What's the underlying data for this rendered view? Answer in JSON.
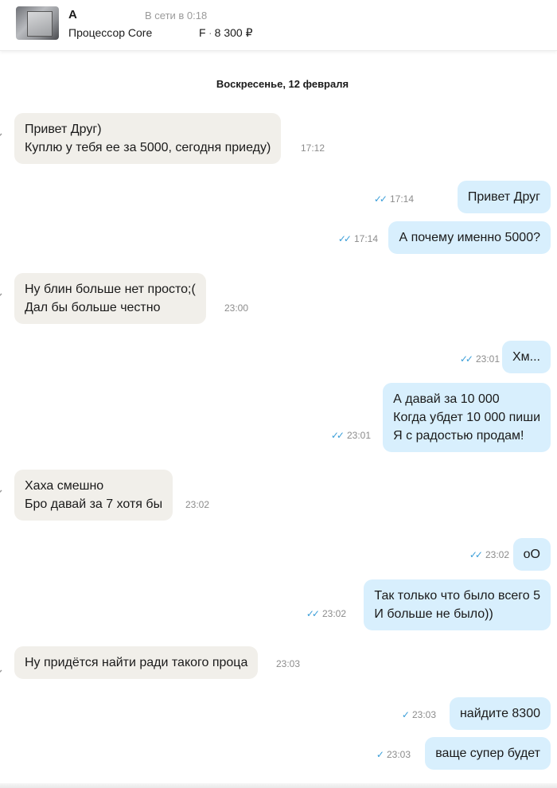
{
  "header": {
    "name": "A",
    "status": "В сети в 0:18",
    "item_title": "Процессор Core",
    "item_letter": "F",
    "price": "8 300 ₽"
  },
  "date_label": "Воскресенье, 12 февраля",
  "messages": [
    {
      "dir": "in",
      "lines": [
        "Привет  Друг)",
        "Куплю у тебя ее за 5000, сегодня приеду)"
      ],
      "time": "17:12"
    },
    {
      "dir": "out",
      "lines": [
        "Привет Друг"
      ],
      "time": "17:14",
      "status": "read"
    },
    {
      "dir": "out",
      "lines": [
        "А почему именно 5000?"
      ],
      "time": "17:14",
      "status": "read"
    },
    {
      "dir": "in",
      "lines": [
        "Ну блин больше нет просто;(",
        "Дал бы больше честно"
      ],
      "time": "23:00"
    },
    {
      "dir": "out",
      "lines": [
        "Хм..."
      ],
      "time": "23:01",
      "status": "read"
    },
    {
      "dir": "out",
      "lines": [
        "А давай за 10 000",
        "Когда убдет 10 000 пиши",
        "Я с радостью продам!"
      ],
      "time": "23:01",
      "status": "read"
    },
    {
      "dir": "in",
      "lines": [
        "Хаха смешно",
        "Бро давай за 7 хотя бы"
      ],
      "time": "23:02"
    },
    {
      "dir": "out",
      "lines": [
        "оО"
      ],
      "time": "23:02",
      "status": "read"
    },
    {
      "dir": "out",
      "lines": [
        "Так только что было всего 5",
        "И больше не было))"
      ],
      "time": "23:02",
      "status": "read"
    },
    {
      "dir": "in",
      "lines": [
        "Ну придётся найти ради такого проца"
      ],
      "time": "23:03"
    },
    {
      "dir": "out",
      "lines": [
        "найдите 8300"
      ],
      "time": "23:03",
      "status": "sent"
    },
    {
      "dir": "out",
      "lines": [
        "ваще супер будет"
      ],
      "time": "23:03",
      "status": "sent"
    }
  ],
  "icons": {
    "read": "double-check-icon",
    "sent": "check-icon"
  },
  "colors": {
    "incoming_bubble": "#f1efea",
    "outgoing_bubble": "#d8effd",
    "check": "#3a9ed8"
  }
}
